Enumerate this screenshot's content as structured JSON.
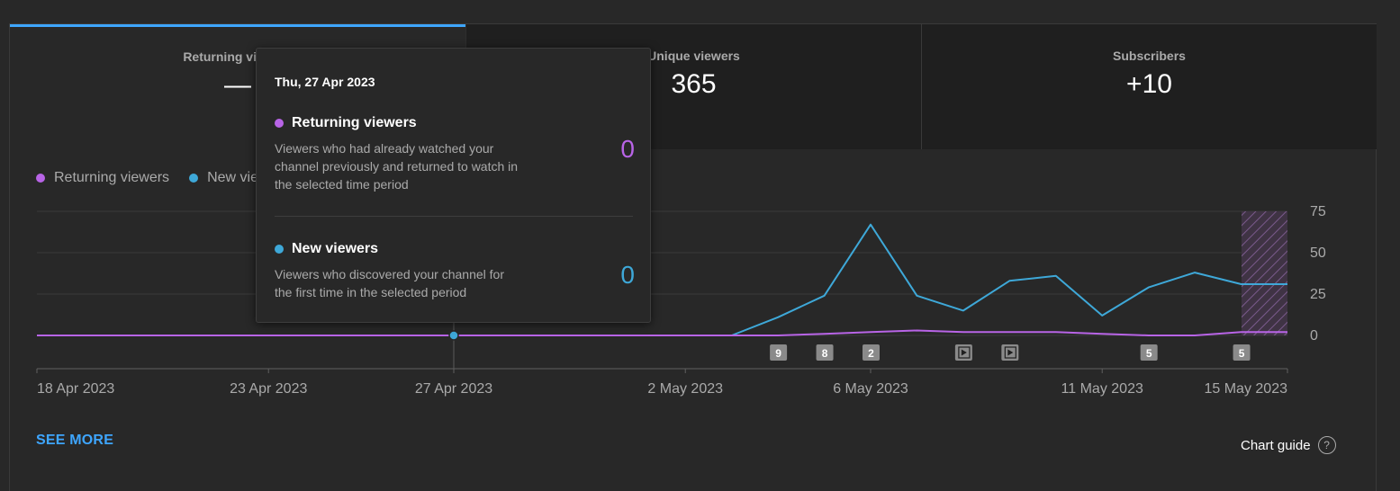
{
  "tabs": [
    {
      "label": "Returning viewers",
      "value": "—"
    },
    {
      "label": "Unique viewers",
      "value": "365"
    },
    {
      "label": "Subscribers",
      "value": "+10"
    }
  ],
  "legend": [
    {
      "label": "Returning viewers",
      "color": "#b864e6"
    },
    {
      "label": "New viewers",
      "color": "#3ea8d8"
    }
  ],
  "chart_data": {
    "type": "line",
    "x": [
      "18 Apr 2023",
      "19 Apr 2023",
      "20 Apr 2023",
      "21 Apr 2023",
      "22 Apr 2023",
      "23 Apr 2023",
      "24 Apr 2023",
      "25 Apr 2023",
      "26 Apr 2023",
      "27 Apr 2023",
      "28 Apr 2023",
      "29 Apr 2023",
      "30 Apr 2023",
      "1 May 2023",
      "2 May 2023",
      "3 May 2023",
      "4 May 2023",
      "5 May 2023",
      "6 May 2023",
      "7 May 2023",
      "8 May 2023",
      "9 May 2023",
      "10 May 2023",
      "11 May 2023",
      "12 May 2023",
      "13 May 2023",
      "14 May 2023",
      "15 May 2023"
    ],
    "series": [
      {
        "name": "Returning viewers",
        "color": "#b864e6",
        "values": [
          0,
          0,
          0,
          0,
          0,
          0,
          0,
          0,
          0,
          0,
          0,
          0,
          0,
          0,
          0,
          0,
          0,
          1,
          2,
          3,
          2,
          2,
          2,
          1,
          0,
          0,
          2,
          2
        ]
      },
      {
        "name": "New viewers",
        "color": "#3ea8d8",
        "values": [
          0,
          0,
          0,
          0,
          0,
          0,
          0,
          0,
          0,
          0,
          0,
          0,
          0,
          0,
          0,
          0,
          11,
          24,
          67,
          24,
          15,
          33,
          36,
          12,
          29,
          38,
          31,
          31
        ]
      }
    ],
    "x_tick_labels": [
      "18 Apr 2023",
      "23 Apr 2023",
      "27 Apr 2023",
      "2 May 2023",
      "6 May 2023",
      "11 May 2023",
      "15 May 2023"
    ],
    "y_ticks": [
      0,
      25,
      50,
      75
    ],
    "ylim": [
      0,
      75
    ],
    "grid": true,
    "y_axis_position": "right",
    "highlight_index": 9,
    "partial_period_start_index": 27,
    "markers": [
      {
        "index": 16,
        "label": "9"
      },
      {
        "index": 17,
        "label": "8"
      },
      {
        "index": 18,
        "label": "2"
      },
      {
        "index": 20,
        "label": "▶"
      },
      {
        "index": 21,
        "label": "▶"
      },
      {
        "index": 24,
        "label": "5"
      },
      {
        "index": 26,
        "label": "5"
      }
    ]
  },
  "tooltip": {
    "date": "Thu, 27 Apr 2023",
    "items": [
      {
        "title": "Returning viewers",
        "color": "#b864e6",
        "desc": "Viewers who had already watched your channel previously and returned to watch in the selected time period",
        "value": "0"
      },
      {
        "title": "New viewers",
        "color": "#3ea8d8",
        "desc": "Viewers who discovered your channel for the first time in the selected period",
        "value": "0"
      }
    ]
  },
  "footer": {
    "see_more": "SEE MORE",
    "chart_guide": "Chart guide",
    "help_icon_glyph": "?"
  },
  "colors": {
    "accent": "#3ea6ff",
    "background": "#282828"
  }
}
